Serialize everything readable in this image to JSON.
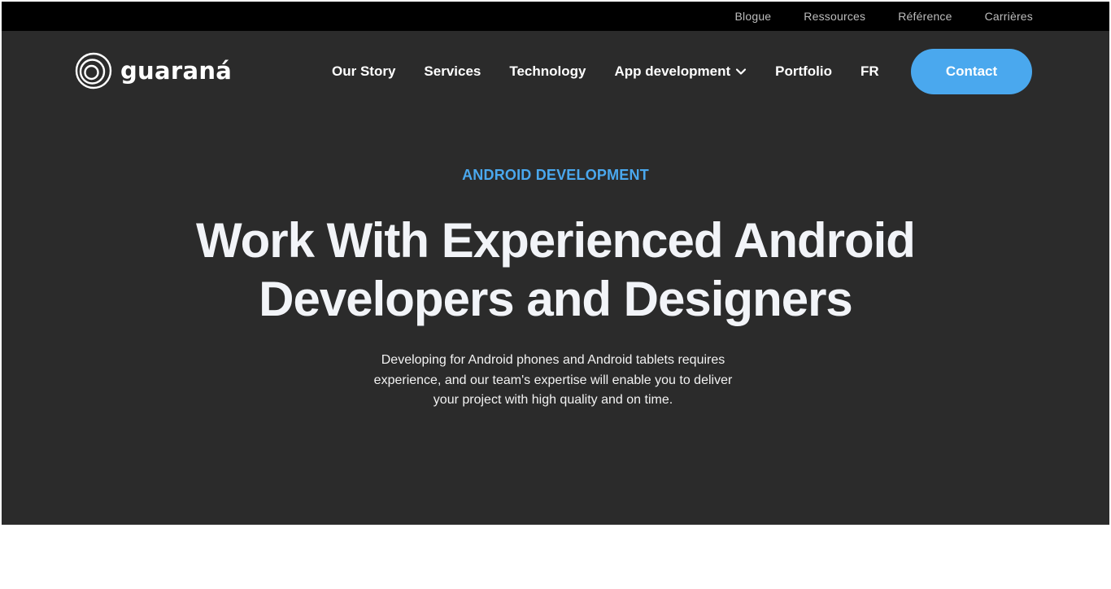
{
  "topbar": {
    "links": [
      "Blogue",
      "Ressources",
      "Référence",
      "Carrières"
    ]
  },
  "brand": {
    "name": "guaraná",
    "icon": "circle-rings-logo-icon"
  },
  "nav": {
    "items": [
      "Our Story",
      "Services",
      "Technology",
      "App development",
      "Portfolio",
      "FR"
    ],
    "dropdown_icon": "chevron-down-icon",
    "contact_label": "Contact"
  },
  "hero": {
    "eyebrow": "ANDROID DEVELOPMENT",
    "headline_line1": "Work With Experienced Android",
    "headline_line2": "Developers and Designers",
    "description": "Developing for Android phones and Android tablets requires experience, and our team's expertise will enable you to deliver your project with high quality and on time."
  },
  "colors": {
    "accent": "#4aa8ee",
    "hero_bg": "#2b2b2b",
    "topbar_bg": "#000000"
  }
}
